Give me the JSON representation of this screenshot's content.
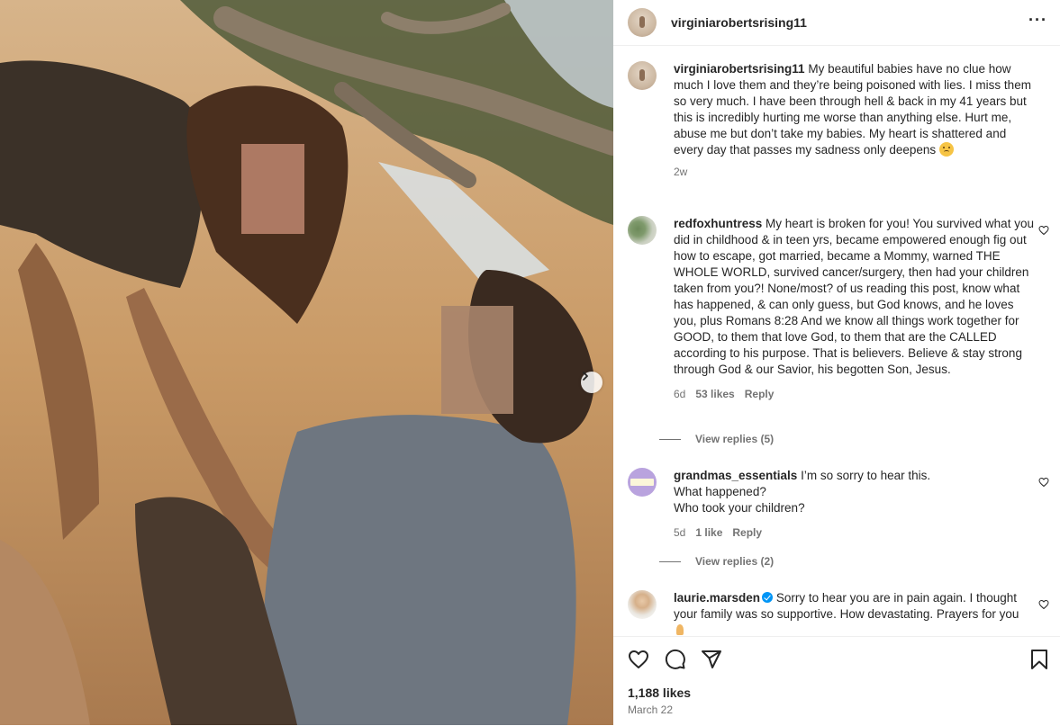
{
  "post": {
    "username": "virginiarobertsrising11",
    "caption": "My beautiful babies have no clue how much I love them and they’re being poisoned with lies. I miss them so very much. I have been through hell & back in my 41 years but this is incredibly hurting me worse than anything else. Hurt me, abuse me but don’t take my babies. My heart is shattered and every day that passes my sadness only deepens",
    "caption_emoji": "sad-face-emoji",
    "caption_time": "2w"
  },
  "comments": [
    {
      "username": "redfoxhuntress",
      "text": "My heart is broken for you! You survived what you did in childhood & in teen yrs, became empowered enough fig out how to escape, got married, became a Mommy, warned THE WHOLE WORLD, survived cancer/surgery, then had your children taken from you?! None/most? of us reading this post, know what has happened, & can only guess, but God knows, and he loves you, plus Romans 8:28 And we know all things work together for GOOD, to them that love God, to them that are the CALLED according to his purpose. That is believers. Believe & stay strong through God & our Savior, his begotten Son, Jesus.",
      "time": "6d",
      "likes": "53 likes",
      "reply": "Reply",
      "view_replies": "View replies (5)"
    },
    {
      "username": "grandmas_essentials",
      "line1": "I’m so sorry to hear this.",
      "line2": "What happened?",
      "line3": "Who took your children?",
      "time": "5d",
      "likes": "1 like",
      "reply": "Reply",
      "view_replies": "View replies (2)"
    },
    {
      "username": "laurie.marsden",
      "verified": true,
      "text": "Sorry to hear you are in pain again. I thought your family was so supportive. How devastating. Prayers for you",
      "emoji": "praying-hands-emoji"
    }
  ],
  "actions": {
    "likes": "1,188 likes",
    "date": "March 22",
    "icons": [
      "heart-icon",
      "comment-icon",
      "share-icon",
      "bookmark-icon"
    ]
  },
  "colors": {
    "text": "#262626",
    "secondary": "#737373",
    "verified": "#0095f6",
    "divider": "#efefef"
  }
}
